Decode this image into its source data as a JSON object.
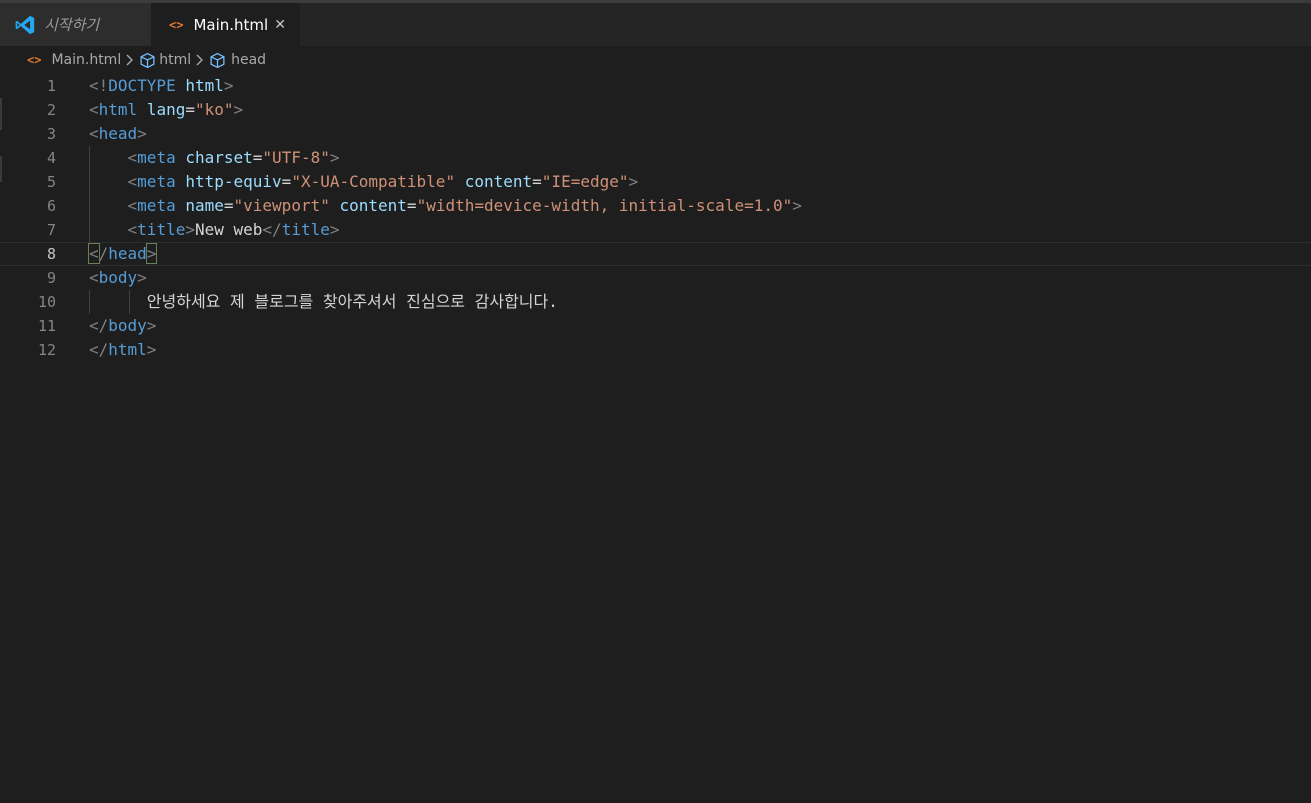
{
  "tabs": {
    "welcome_label": "시작하기",
    "main_label": "Main.html",
    "close_glyph": "✕"
  },
  "breadcrumb": {
    "file": "Main.html",
    "items": [
      "html",
      "head"
    ]
  },
  "editor": {
    "active_line": 8,
    "lines": [
      {
        "n": "1",
        "tokens": [
          [
            "p",
            "<!"
          ],
          [
            "t",
            "DOCTYPE"
          ],
          [
            "x",
            " "
          ],
          [
            "a",
            "html"
          ],
          [
            "p",
            ">"
          ]
        ]
      },
      {
        "n": "2",
        "tokens": [
          [
            "p",
            "<"
          ],
          [
            "t",
            "html"
          ],
          [
            "x",
            " "
          ],
          [
            "a",
            "lang"
          ],
          [
            "x",
            "="
          ],
          [
            "s",
            "\"ko\""
          ],
          [
            "p",
            ">"
          ]
        ]
      },
      {
        "n": "3",
        "tokens": [
          [
            "p",
            "<"
          ],
          [
            "t",
            "head"
          ],
          [
            "p",
            ">"
          ]
        ]
      },
      {
        "n": "4",
        "tokens": [
          [
            "x",
            "    "
          ],
          [
            "p",
            "<"
          ],
          [
            "t",
            "meta"
          ],
          [
            "x",
            " "
          ],
          [
            "a",
            "charset"
          ],
          [
            "x",
            "="
          ],
          [
            "s",
            "\"UTF-8\""
          ],
          [
            "p",
            ">"
          ]
        ]
      },
      {
        "n": "5",
        "tokens": [
          [
            "x",
            "    "
          ],
          [
            "p",
            "<"
          ],
          [
            "t",
            "meta"
          ],
          [
            "x",
            " "
          ],
          [
            "a",
            "http-equiv"
          ],
          [
            "x",
            "="
          ],
          [
            "s",
            "\"X-UA-Compatible\""
          ],
          [
            "x",
            " "
          ],
          [
            "a",
            "content"
          ],
          [
            "x",
            "="
          ],
          [
            "s",
            "\"IE=edge\""
          ],
          [
            "p",
            ">"
          ]
        ]
      },
      {
        "n": "6",
        "tokens": [
          [
            "x",
            "    "
          ],
          [
            "p",
            "<"
          ],
          [
            "t",
            "meta"
          ],
          [
            "x",
            " "
          ],
          [
            "a",
            "name"
          ],
          [
            "x",
            "="
          ],
          [
            "s",
            "\"viewport\""
          ],
          [
            "x",
            " "
          ],
          [
            "a",
            "content"
          ],
          [
            "x",
            "="
          ],
          [
            "s",
            "\"width=device-width, initial-scale=1.0\""
          ],
          [
            "p",
            ">"
          ]
        ]
      },
      {
        "n": "7",
        "tokens": [
          [
            "x",
            "    "
          ],
          [
            "p",
            "<"
          ],
          [
            "t",
            "title"
          ],
          [
            "p",
            ">"
          ],
          [
            "x",
            "New web"
          ],
          [
            "p",
            "</"
          ],
          [
            "t",
            "title"
          ],
          [
            "p",
            ">"
          ]
        ]
      },
      {
        "n": "8",
        "tokens": [
          [
            "b",
            "<"
          ],
          [
            "p",
            "/"
          ],
          [
            "t",
            "head"
          ],
          [
            "b",
            ">"
          ]
        ]
      },
      {
        "n": "9",
        "tokens": [
          [
            "p",
            "<"
          ],
          [
            "t",
            "body"
          ],
          [
            "p",
            ">"
          ]
        ]
      },
      {
        "n": "10",
        "tokens": [
          [
            "x",
            "      안녕하세요 제 블로그를 찾아주셔서 진심으로 감사합니다."
          ]
        ]
      },
      {
        "n": "11",
        "tokens": [
          [
            "p",
            "</"
          ],
          [
            "t",
            "body"
          ],
          [
            "p",
            ">"
          ]
        ]
      },
      {
        "n": "12",
        "tokens": [
          [
            "p",
            "</"
          ],
          [
            "t",
            "html"
          ],
          [
            "p",
            ">"
          ]
        ]
      }
    ]
  },
  "colors": {
    "background": "#1e1e1e",
    "tag": "#569cd6",
    "attribute": "#9cdcfe",
    "string": "#ce9178",
    "punctuation": "#808080",
    "text": "#d4d4d4",
    "html_icon": "#e37933",
    "vscode_blue": "#23a9f2"
  }
}
